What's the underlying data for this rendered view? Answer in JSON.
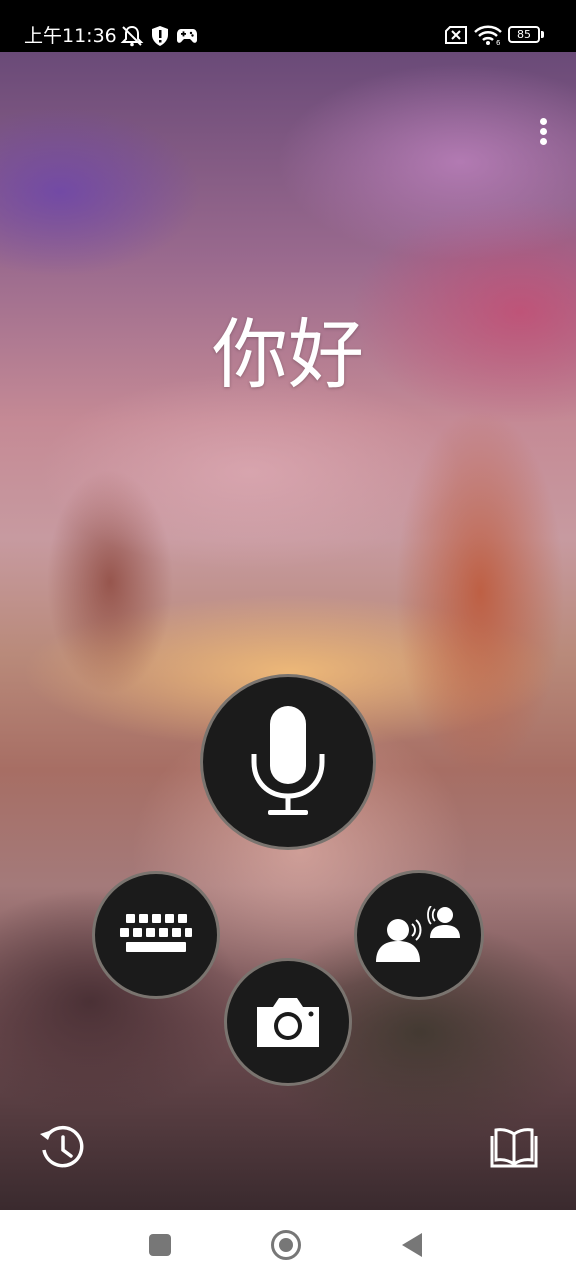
{
  "status_bar": {
    "time": "上午11:36",
    "battery_level": "85",
    "icons": [
      "bell-off-icon",
      "shield-alert-icon",
      "gamepad-icon",
      "no-sim-icon",
      "wifi-icon",
      "battery-icon"
    ]
  },
  "main": {
    "greeting_text": "你好",
    "menu_icon": "more-vert-icon",
    "buttons": {
      "microphone": "microphone-icon",
      "keyboard": "keyboard-icon",
      "camera": "camera-icon",
      "conversation": "conversation-icon",
      "history": "history-icon",
      "phrasebook": "book-icon"
    }
  },
  "nav_bar": {
    "icons": [
      "recents-square-icon",
      "home-circle-icon",
      "back-triangle-icon"
    ]
  },
  "colors": {
    "button_bg": "#1b1b1b",
    "icon": "#ffffff",
    "nav_icon": "#777777",
    "nav_bg": "#ffffff"
  }
}
